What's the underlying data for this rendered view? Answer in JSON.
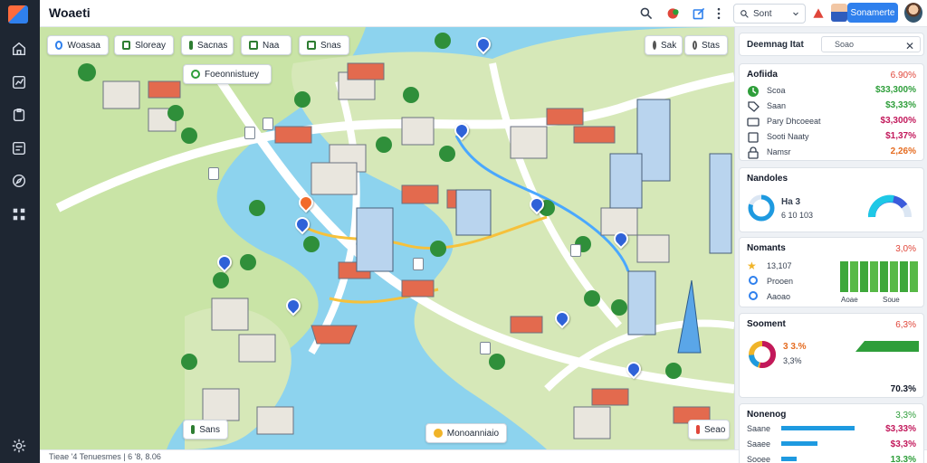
{
  "app": {
    "title": "Woaeti"
  },
  "topbar": {
    "search_label": "Sont",
    "primary_button": "Sonamerte"
  },
  "map": {
    "chips": [
      {
        "label": "Woasaa"
      },
      {
        "label": "Sloreay"
      },
      {
        "label": "Sacnas"
      },
      {
        "label": "Naa"
      },
      {
        "label": "Snas"
      }
    ],
    "filter_chip": "Foeonnistuey",
    "right_chips": [
      {
        "label": "Sak"
      },
      {
        "label": "Stas"
      }
    ],
    "bottom_left_chip": "Sans",
    "bottom_center_chip": "Monoanniaio",
    "bottom_right_chip": "Seao"
  },
  "statusbar": {
    "text": "Tieae '4 Tenuesmes | 6 '8, 8.06"
  },
  "panel": {
    "header": "Deemnag Itat",
    "search_placeholder": "Soao",
    "activity": {
      "title": "Aofiida",
      "title_value": "6.90%",
      "rows": [
        {
          "icon": "clock-icon",
          "label": "Scoa",
          "value": "$33,300%",
          "color": "#2e9e3a"
        },
        {
          "icon": "tag-icon",
          "label": "Saan",
          "value": "$3,33%",
          "color": "#2e9e3a"
        },
        {
          "icon": "card-icon",
          "label": "Pary Dhcoeeat",
          "value": "$3,300%",
          "color": "#c2185b"
        },
        {
          "icon": "box-icon",
          "label": "Sooti Naaty",
          "value": "$1,37%",
          "color": "#c2185b"
        },
        {
          "icon": "lock-icon",
          "label": "Namsr",
          "value": "2,26%",
          "color": "#e56b1f"
        }
      ]
    },
    "nandotes": {
      "title": "Nandoles",
      "line1": "Ha 3",
      "line2": "6 10 103"
    },
    "nomants": {
      "title": "Nomants",
      "title_value": "3,0%",
      "rows": [
        {
          "label": "13,107"
        },
        {
          "label": "Prooen"
        },
        {
          "label": "Aaoao"
        }
      ],
      "bar_labels": [
        "Aoae",
        "Soue"
      ],
      "bars": [
        0.8,
        0.82,
        0.82,
        0.82,
        0.82,
        0.82,
        0.82,
        0.82
      ]
    },
    "scoment": {
      "title": "Sooment",
      "title_value": "6,3%",
      "line1": "3 3.%",
      "line2": "3,3%",
      "value": "70.3%"
    },
    "nonenog": {
      "title": "Nonenog",
      "title_value": "3,3%",
      "rows": [
        {
          "label": "Saane",
          "value": "$3,33%",
          "color": "#c2185b",
          "bar": 0.78
        },
        {
          "label": "Saaee",
          "value": "$3,3%",
          "color": "#c2185b",
          "bar": 0.38
        },
        {
          "label": "Sooee",
          "value": "13.3%",
          "color": "#2e9e3a",
          "bar": 0.16
        }
      ]
    }
  }
}
